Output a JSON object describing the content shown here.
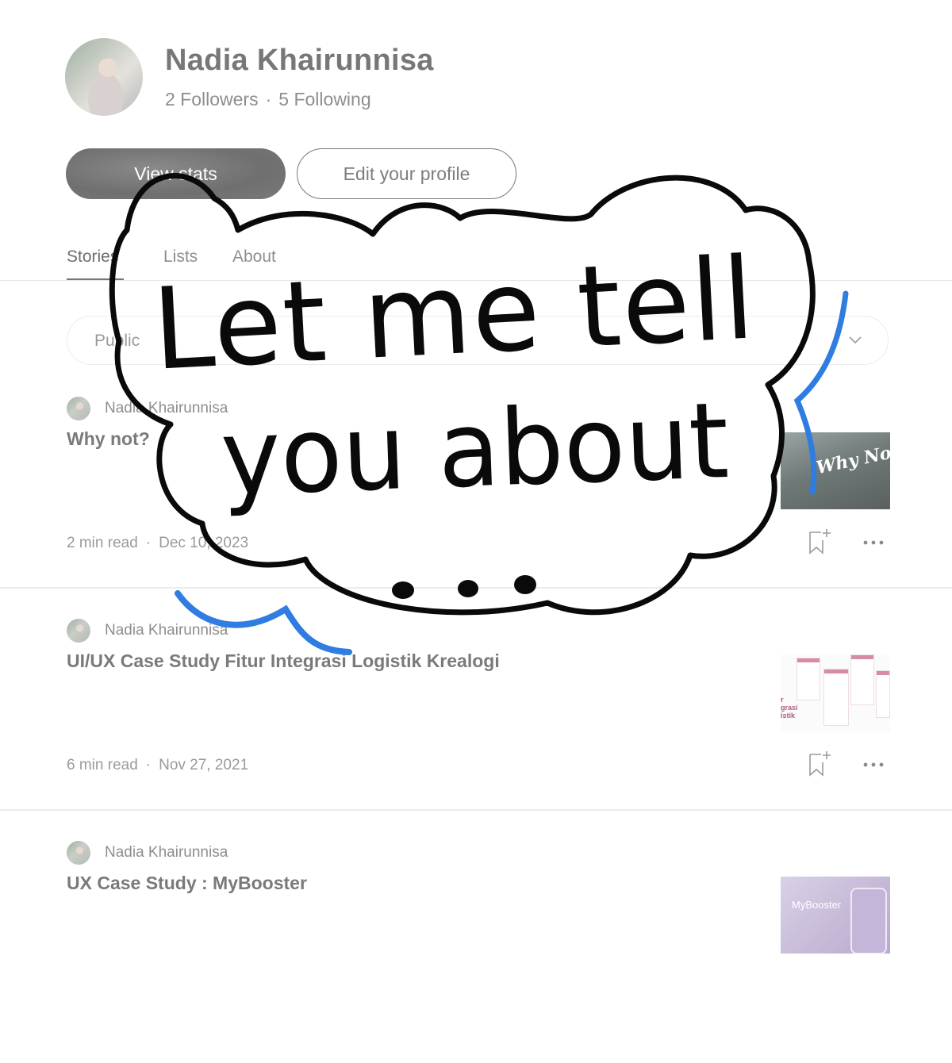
{
  "profile": {
    "name": "Nadia Khairunnisa",
    "followers": "2 Followers",
    "separator": "·",
    "following": "5 Following"
  },
  "actions": {
    "stats_label": "View stats",
    "edit_label": "Edit your profile"
  },
  "tabs": [
    {
      "label": "Stories"
    },
    {
      "label": "Lists"
    },
    {
      "label": "About"
    }
  ],
  "filter": {
    "value": "Public"
  },
  "stories": [
    {
      "author": "Nadia Khairunnisa",
      "title": "Why not?",
      "read_time": "2 min read",
      "date": "Dec 10, 2023",
      "thumb_text": "Why Not?"
    },
    {
      "author": "Nadia Khairunnisa",
      "title": "UI/UX Case Study Fitur Integrasi Logistik Krealogi",
      "read_time": "6 min read",
      "date": "Nov 27, 2021",
      "thumb_text": "r\ngrasi\nistik"
    },
    {
      "author": "Nadia Khairunnisa",
      "title": "UX Case Study : MyBooster",
      "read_time": "",
      "date": "",
      "thumb_text": "MyBooster"
    }
  ],
  "overlay": {
    "line1": "Let me tell",
    "line2": "you about",
    "ellipsis": "• • •"
  },
  "colors": {
    "ink": "#0a0a0a",
    "accent_blue": "#2f7de1",
    "muted_text": "#8e8e8e",
    "button_fill": "#777777"
  }
}
